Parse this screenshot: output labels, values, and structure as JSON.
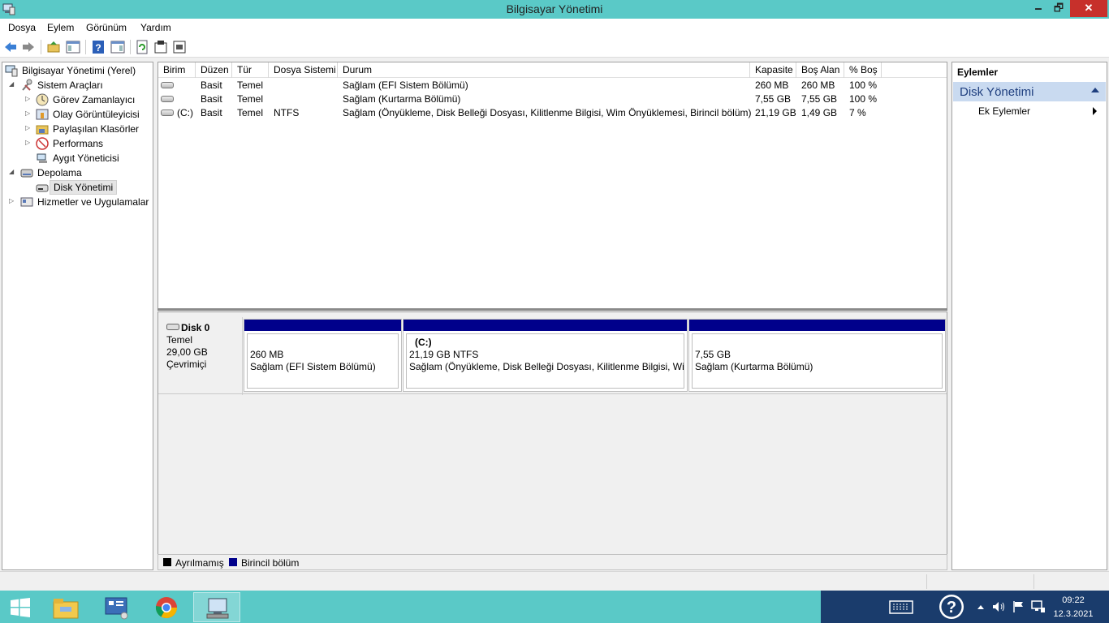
{
  "window": {
    "title": "Bilgisayar Yönetimi",
    "minimize": "🗕",
    "maximize": "🗗",
    "close": "✕"
  },
  "menu": [
    "Dosya",
    "Eylem",
    "Görünüm",
    "Yardım"
  ],
  "tree": {
    "root": "Bilgisayar Yönetimi (Yerel)",
    "system_tools": "Sistem Araçları",
    "task_scheduler": "Görev Zamanlayıcı",
    "event_viewer": "Olay Görüntüleyicisi",
    "shared_folders": "Paylaşılan Klasörler",
    "performance": "Performans",
    "device_manager": "Aygıt Yöneticisi",
    "storage": "Depolama",
    "disk_management": "Disk Yönetimi",
    "services": "Hizmetler ve Uygulamalar"
  },
  "table": {
    "columns": [
      "Birim",
      "Düzen",
      "Tür",
      "Dosya Sistemi",
      "Durum",
      "Kapasite",
      "Boş Alan",
      "% Boş"
    ],
    "rows": [
      {
        "volume": "",
        "layout": "Basit",
        "type": "Temel",
        "fs": "",
        "status": "Sağlam (EFI Sistem Bölümü)",
        "capacity": "260 MB",
        "free": "260 MB",
        "pct": "100 %"
      },
      {
        "volume": "",
        "layout": "Basit",
        "type": "Temel",
        "fs": "",
        "status": "Sağlam (Kurtarma Bölümü)",
        "capacity": "7,55 GB",
        "free": "7,55 GB",
        "pct": "100 %"
      },
      {
        "volume": "(C:)",
        "layout": "Basit",
        "type": "Temel",
        "fs": "NTFS",
        "status": "Sağlam (Önyükleme, Disk Belleği Dosyası, Kilitlenme Bilgisi, Wim Önyüklemesi, Birincil bölüm)",
        "capacity": "21,19 GB",
        "free": "1,49 GB",
        "pct": "7 %"
      }
    ]
  },
  "disk": {
    "name": "Disk 0",
    "type": "Temel",
    "size": "29,00 GB",
    "state": "Çevrimiçi",
    "partitions": [
      {
        "label": "",
        "size": "260 MB",
        "status": "Sağlam (EFI Sistem Bölümü)"
      },
      {
        "label": "(C:)",
        "size": "21,19 GB NTFS",
        "status": "Sağlam (Önyükleme, Disk Belleği Dosyası, Kilitlenme Bilgisi, Win"
      },
      {
        "label": "",
        "size": "7,55 GB",
        "status": "Sağlam (Kurtarma Bölümü)"
      }
    ]
  },
  "legend": {
    "unallocated": "Ayrılmamış",
    "primary": "Birincil bölüm",
    "unallocated_color": "#000000",
    "primary_color": "#00008b"
  },
  "actions": {
    "header": "Eylemler",
    "section": "Disk Yönetimi",
    "more": "Ek Eylemler"
  },
  "taskbar": {
    "time": "09:22",
    "date": "12.3.2021"
  },
  "colors": {
    "titlebar": "#5ac9c7",
    "partition_bar": "#00008b",
    "close": "#c7302b"
  }
}
